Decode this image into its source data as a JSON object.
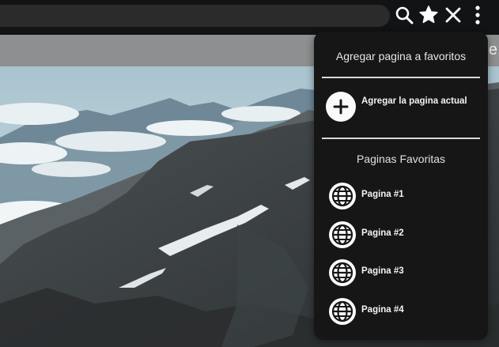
{
  "toolbar": {
    "icons": [
      "search-icon",
      "star-icon",
      "close-icon",
      "more-vertical-icon"
    ]
  },
  "strip": {
    "letter": "e"
  },
  "panel": {
    "title": "Agregar pagina a favoritos",
    "add_current_label": "Agregar la pagina actual",
    "favorites_title": "Paginas Favoritas",
    "favorites": [
      {
        "label": "Pagina #1",
        "icon": "globe-icon"
      },
      {
        "label": "Pagina #2",
        "icon": "globe-icon"
      },
      {
        "label": "Pagina #3",
        "icon": "globe-icon"
      },
      {
        "label": "Pagina #4",
        "icon": "globe-icon"
      }
    ]
  },
  "colors": {
    "toolbar": "#121314",
    "address_bar": "#2b2b2c",
    "panel": "#161616",
    "strip": "#8d8f90",
    "text": "#f4f4f4"
  }
}
